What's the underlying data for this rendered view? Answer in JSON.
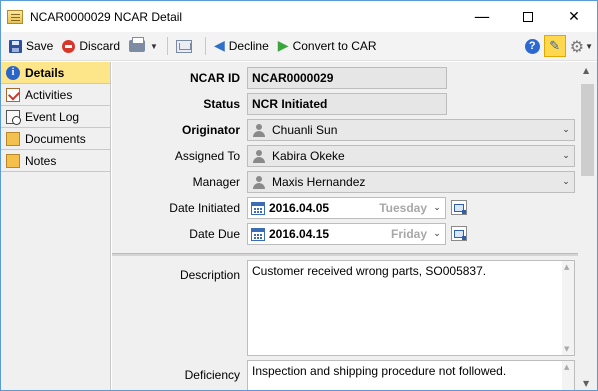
{
  "window": {
    "title": "NCAR0000029 NCAR Detail",
    "minimize": "—",
    "close": "✕"
  },
  "toolbar": {
    "save": "Save",
    "discard": "Discard",
    "decline": "Decline",
    "convert": "Convert to CAR",
    "help": "?"
  },
  "sidebar": {
    "items": [
      {
        "label": "Details",
        "icon": "info-icon",
        "active": true
      },
      {
        "label": "Activities",
        "icon": "checklist-icon",
        "active": false
      },
      {
        "label": "Event Log",
        "icon": "log-icon",
        "active": false
      },
      {
        "label": "Documents",
        "icon": "folder-icon",
        "active": false
      },
      {
        "label": "Notes",
        "icon": "note-icon",
        "active": false
      }
    ]
  },
  "form": {
    "ncar_id": {
      "label": "NCAR ID",
      "value": "NCAR0000029"
    },
    "status": {
      "label": "Status",
      "value": "NCR Initiated"
    },
    "originator": {
      "label": "Originator",
      "value": "Chuanli Sun"
    },
    "assigned_to": {
      "label": "Assigned To",
      "value": "Kabira Okeke"
    },
    "manager": {
      "label": "Manager",
      "value": "Maxis Hernandez"
    },
    "date_initiated": {
      "label": "Date Initiated",
      "value": "2016.04.05",
      "day": "Tuesday"
    },
    "date_due": {
      "label": "Date Due",
      "value": "2016.04.15",
      "day": "Friday"
    },
    "description": {
      "label": "Description",
      "value": "Customer received wrong parts, SO005837."
    },
    "deficiency": {
      "label": "Deficiency",
      "value": "Inspection and shipping procedure not followed."
    }
  },
  "colors": {
    "active_tab": "#fde58a",
    "window_border": "#5b9bd5",
    "pin_highlight": "#ffd84d"
  }
}
